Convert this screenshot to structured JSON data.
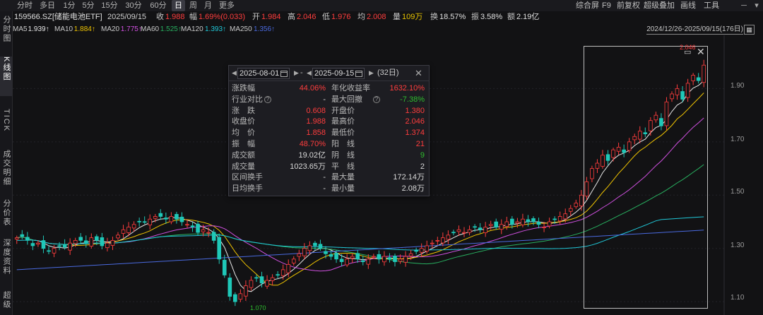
{
  "periods": [
    "分时",
    "多日",
    "1分",
    "5分",
    "15分",
    "30分",
    "60分",
    "日",
    "周",
    "月",
    "更多"
  ],
  "active_period": "日",
  "toolbar": [
    "综合屏",
    "F9",
    "前复权",
    "超级叠加",
    "画线",
    "工具"
  ],
  "sidebar": [
    "分时图",
    "K线图",
    "TICK",
    "成交明细",
    "分价表",
    "深度资料",
    "超级"
  ],
  "quote": {
    "code_name": "159566.SZ[储能电池ETF]",
    "date": "2025/09/15",
    "close_label": "收",
    "close": "1.988",
    "change_label": "幅",
    "change": "1.69%(0.033)",
    "open_label": "开",
    "open": "1.984",
    "high_label": "高",
    "high": "2.046",
    "low_label": "低",
    "low": "1.976",
    "avg_label": "均",
    "avg": "2.008",
    "vol_label": "量",
    "vol": "109万",
    "turnover_label": "换",
    "turnover": "18.57%",
    "amplitude_label": "振",
    "amplitude": "3.58%",
    "amount_label": "额",
    "amount": "2.19亿"
  },
  "ma": [
    {
      "label": "MA5",
      "value": "1.939↑",
      "color": "#e8e8e8"
    },
    {
      "label": "MA10",
      "value": "1.884↑",
      "color": "#f0c400"
    },
    {
      "label": "MA20",
      "value": "1.775↑",
      "color": "#d050e0"
    },
    {
      "label": "MA60",
      "value": "1.525↑",
      "color": "#28b060"
    },
    {
      "label": "MA120",
      "value": "1.393↑",
      "color": "#20c8d8"
    },
    {
      "label": "MA250",
      "value": "1.356↑",
      "color": "#4a6ae0"
    }
  ],
  "range_text": "2024/12/26-2025/09/15(176日)",
  "price_axis": [
    "1.90",
    "1.70",
    "1.50",
    "1.30",
    "1.10"
  ],
  "annotations": {
    "high": "2.046",
    "low": "1.070"
  },
  "popup": {
    "start_date": "2025-08-01",
    "end_date": "2025-09-15",
    "sep": "-",
    "days": "(32日)",
    "rows": [
      {
        "l1": "涨跌幅",
        "v1": "44.06%",
        "c1": "red",
        "l2": "年化收益率",
        "v2": "1632.10%",
        "c2": "red"
      },
      {
        "l1": "行业对比",
        "v1": "-",
        "c1": "white",
        "l2": "最大回撤",
        "v2": "-7.38%",
        "c2": "green",
        "q1": true,
        "q2": true
      },
      {
        "l1": "涨　跌",
        "v1": "0.608",
        "c1": "red",
        "l2": "开盘价",
        "v2": "1.380",
        "c2": "red"
      },
      {
        "l1": "收盘价",
        "v1": "1.988",
        "c1": "red",
        "l2": "最高价",
        "v2": "2.046",
        "c2": "red"
      },
      {
        "l1": "均　价",
        "v1": "1.858",
        "c1": "red",
        "l2": "最低价",
        "v2": "1.374",
        "c2": "red"
      },
      {
        "l1": "振　幅",
        "v1": "48.70%",
        "c1": "red",
        "l2": "阳　线",
        "v2": "21",
        "c2": "red"
      },
      {
        "l1": "成交额",
        "v1": "19.02亿",
        "c1": "white",
        "l2": "阴　线",
        "v2": "9",
        "c2": "green"
      },
      {
        "l1": "成交量",
        "v1": "1023.65万",
        "c1": "white",
        "l2": "平　线",
        "v2": "2",
        "c2": "white"
      },
      {
        "l1": "区间换手",
        "v1": "-",
        "c1": "white",
        "l2": "最大量",
        "v2": "172.14万",
        "c2": "white"
      },
      {
        "l1": "日均换手",
        "v1": "-",
        "c1": "white",
        "l2": "最小量",
        "v2": "2.08万",
        "c2": "white"
      }
    ]
  },
  "chart_data": {
    "type": "candlestick",
    "ylim": [
      1.05,
      2.1
    ],
    "closes": [
      1.34,
      1.345,
      1.33,
      1.31,
      1.32,
      1.3,
      1.29,
      1.3,
      1.31,
      1.305,
      1.32,
      1.33,
      1.33,
      1.32,
      1.34,
      1.33,
      1.31,
      1.32,
      1.33,
      1.35,
      1.37,
      1.38,
      1.39,
      1.4,
      1.4,
      1.41,
      1.42,
      1.42,
      1.41,
      1.42,
      1.41,
      1.4,
      1.39,
      1.38,
      1.36,
      1.37,
      1.36,
      1.33,
      1.26,
      1.2,
      1.12,
      1.1,
      1.13,
      1.16,
      1.18,
      1.19,
      1.17,
      1.18,
      1.19,
      1.2,
      1.22,
      1.24,
      1.26,
      1.28,
      1.3,
      1.31,
      1.31,
      1.3,
      1.28,
      1.27,
      1.26,
      1.25,
      1.26,
      1.27,
      1.26,
      1.25,
      1.26,
      1.27,
      1.26,
      1.27,
      1.26,
      1.25,
      1.26,
      1.27,
      1.28,
      1.29,
      1.3,
      1.31,
      1.32,
      1.33,
      1.34,
      1.35,
      1.36,
      1.37,
      1.36,
      1.37,
      1.38,
      1.37,
      1.38,
      1.39,
      1.38,
      1.39,
      1.4,
      1.39,
      1.4,
      1.41,
      1.4,
      1.4,
      1.39,
      1.38,
      1.4,
      1.41,
      1.42,
      1.43,
      1.45,
      1.47,
      1.5,
      1.55,
      1.6,
      1.62,
      1.65,
      1.63,
      1.67,
      1.68,
      1.66,
      1.7,
      1.72,
      1.74,
      1.73,
      1.78,
      1.8,
      1.76,
      1.85,
      1.88,
      1.9,
      1.86,
      1.92,
      1.95,
      1.93,
      1.988
    ],
    "ma": {
      "MA5": {
        "color": "#e8e8e8"
      },
      "MA10": {
        "color": "#f0c400"
      },
      "MA20": {
        "color": "#d050e0"
      },
      "MA60": {
        "color": "#28b060"
      },
      "MA120": {
        "color": "#20c8d8"
      },
      "MA250": {
        "color": "#4a6ae0"
      }
    },
    "up_color": "#ff3d3d",
    "down_color": "#1fc8b8"
  }
}
